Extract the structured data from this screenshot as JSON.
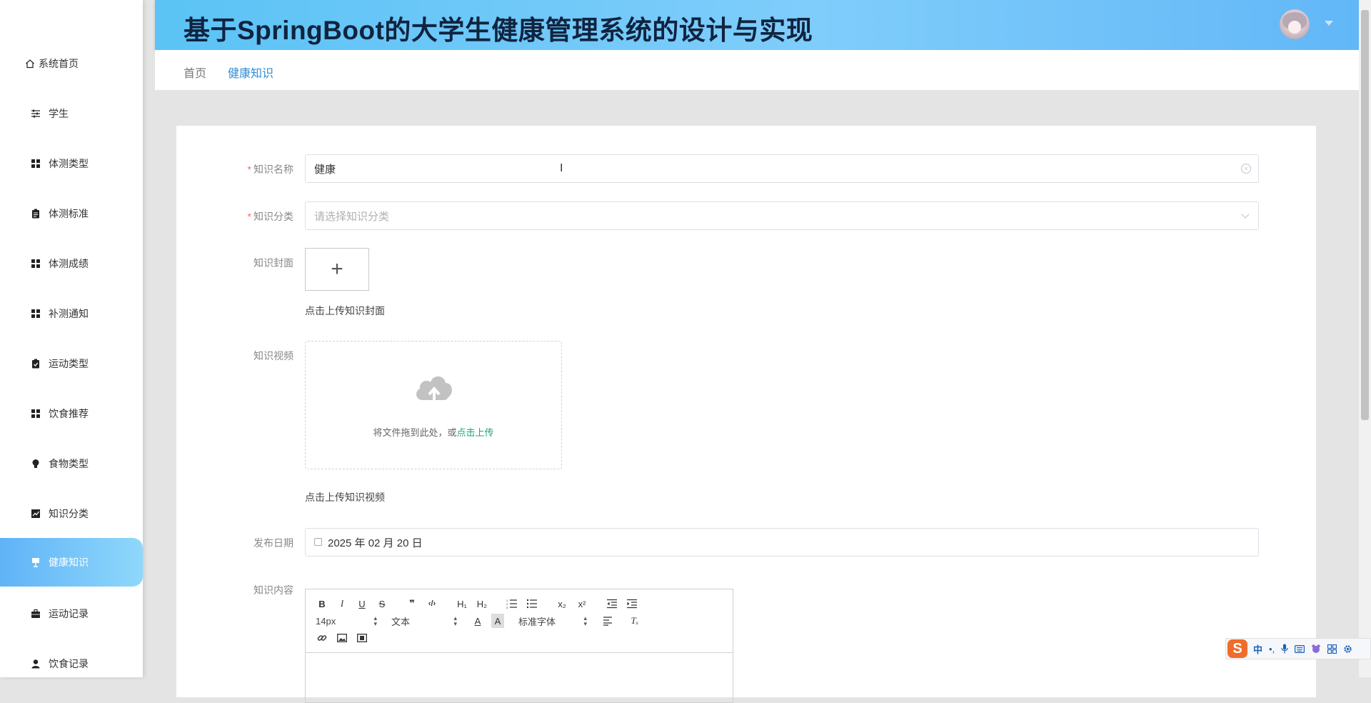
{
  "app": {
    "title": "基于SpringBoot的大学生健康管理系统的设计与实现"
  },
  "sidebar": {
    "items": [
      {
        "label": "系统首页",
        "icon": "home-icon",
        "active": false
      },
      {
        "label": "学生",
        "icon": "sliders-icon",
        "active": false
      },
      {
        "label": "体测类型",
        "icon": "grid-icon",
        "active": false
      },
      {
        "label": "体测标准",
        "icon": "clipboard-icon",
        "active": false
      },
      {
        "label": "体测成绩",
        "icon": "grid-icon",
        "active": false
      },
      {
        "label": "补测通知",
        "icon": "grid-icon",
        "active": false
      },
      {
        "label": "运动类型",
        "icon": "clipboard-check-icon",
        "active": false
      },
      {
        "label": "饮食推荐",
        "icon": "grid-icon",
        "active": false
      },
      {
        "label": "食物类型",
        "icon": "bulb-icon",
        "active": false
      },
      {
        "label": "知识分类",
        "icon": "chart-icon",
        "active": false
      },
      {
        "label": "健康知识",
        "icon": "presentation-icon",
        "active": true
      },
      {
        "label": "运动记录",
        "icon": "briefcase-icon",
        "active": false
      },
      {
        "label": "饮食记录",
        "icon": "user-icon",
        "active": false
      }
    ]
  },
  "breadcrumb": {
    "home": "首页",
    "current": "健康知识"
  },
  "form": {
    "name": {
      "label": "知识名称",
      "value": "健康"
    },
    "category": {
      "label": "知识分类",
      "placeholder": "请选择知识分类"
    },
    "cover": {
      "label": "知识封面",
      "tip": "点击上传知识封面"
    },
    "video": {
      "label": "知识视频",
      "drop_text": "将文件拖到此处，或",
      "drop_link": "点击上传",
      "tip": "点击上传知识视频"
    },
    "date": {
      "label": "发布日期",
      "value": "2025 年 02 月 20 日"
    },
    "content": {
      "label": "知识内容",
      "font_size": "14px",
      "paragraph": "文本",
      "font_family": "标准字体"
    }
  },
  "colors": {
    "accent": "#5fb3f7",
    "header": "#6ec6f8",
    "required": "#f56c6c",
    "link": "#1aa37f"
  },
  "ime": {
    "lang": "中"
  }
}
